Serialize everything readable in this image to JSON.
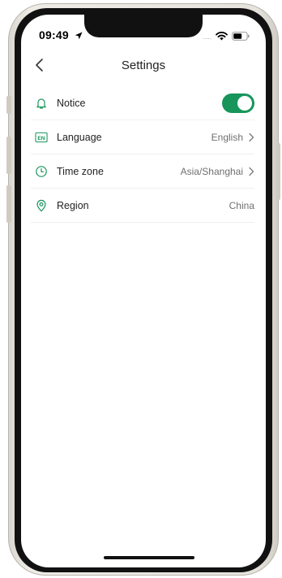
{
  "status_bar": {
    "time": "09:49",
    "signal": "....."
  },
  "header": {
    "title": "Settings"
  },
  "settings": {
    "items": [
      {
        "label": "Notice",
        "icon": "bell-icon",
        "toggle_on": true
      },
      {
        "label": "Language",
        "icon": "en-language-icon",
        "value": "English"
      },
      {
        "label": "Time zone",
        "icon": "clock-icon",
        "value": "Asia/Shanghai"
      },
      {
        "label": "Region",
        "icon": "location-pin-icon",
        "value": "China"
      }
    ]
  },
  "colors": {
    "accent": "#17955b",
    "icon": "#17955b"
  }
}
